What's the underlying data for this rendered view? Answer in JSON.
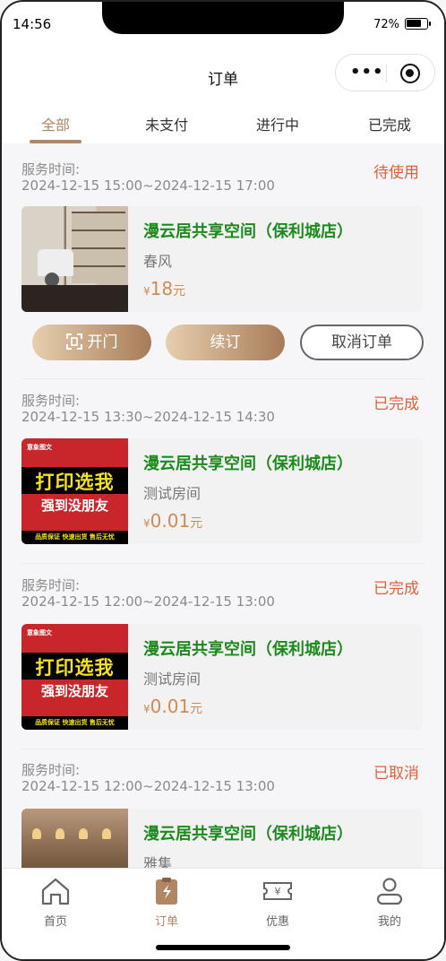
{
  "status_bar": {
    "time": "14:56",
    "battery": "72%"
  },
  "nav": {
    "title": "订单"
  },
  "tabs": [
    {
      "label": "全部",
      "active": true
    },
    {
      "label": "未支付",
      "active": false
    },
    {
      "label": "进行中",
      "active": false
    },
    {
      "label": "已完成",
      "active": false
    }
  ],
  "orders": [
    {
      "service_label": "服务时间:",
      "service_time": "2024-12-15 15:00~2024-12-15 17:00",
      "status": "待使用",
      "store": "漫云居共享空间（保利城店）",
      "room": "春风",
      "currency": "¥",
      "price": "18",
      "unit": "元",
      "thumb": "room-photo",
      "actions": {
        "open": "开门",
        "renew": "续订",
        "cancel": "取消订单"
      }
    },
    {
      "service_label": "服务时间:",
      "service_time": "2024-12-15 13:30~2024-12-15 14:30",
      "status": "已完成",
      "store": "漫云居共享空间（保利城店）",
      "room": "测试房间",
      "currency": "¥",
      "price": "0.01",
      "unit": "元",
      "thumb": "print-poster",
      "poster": {
        "top": "意象图文",
        "line1": "打印选我",
        "line2": "强到没朋友",
        "bottom": "品质保证 快速出货 售后无忧"
      }
    },
    {
      "service_label": "服务时间:",
      "service_time": "2024-12-15 12:00~2024-12-15 13:00",
      "status": "已完成",
      "store": "漫云居共享空间（保利城店）",
      "room": "测试房间",
      "currency": "¥",
      "price": "0.01",
      "unit": "元",
      "thumb": "print-poster",
      "poster": {
        "top": "意象图文",
        "line1": "打印选我",
        "line2": "强到没朋友",
        "bottom": "品质保证 快速出货 售后无忧"
      }
    },
    {
      "service_label": "服务时间:",
      "service_time": "2024-12-15 12:00~2024-12-15 13:00",
      "status": "已取消",
      "store": "漫云居共享空间（保利城店）",
      "room": "雅集",
      "thumb": "lounge-photo"
    }
  ],
  "tabbar": [
    {
      "label": "首页",
      "icon": "home-icon",
      "active": false
    },
    {
      "label": "订单",
      "icon": "order-icon",
      "active": true
    },
    {
      "label": "优惠",
      "icon": "coupon-icon",
      "active": false
    },
    {
      "label": "我的",
      "icon": "profile-icon",
      "active": false
    }
  ],
  "colors": {
    "accent": "#b08664",
    "status": "#e0603c",
    "store_name": "#1d8a1d",
    "price": "#cf8a56"
  }
}
